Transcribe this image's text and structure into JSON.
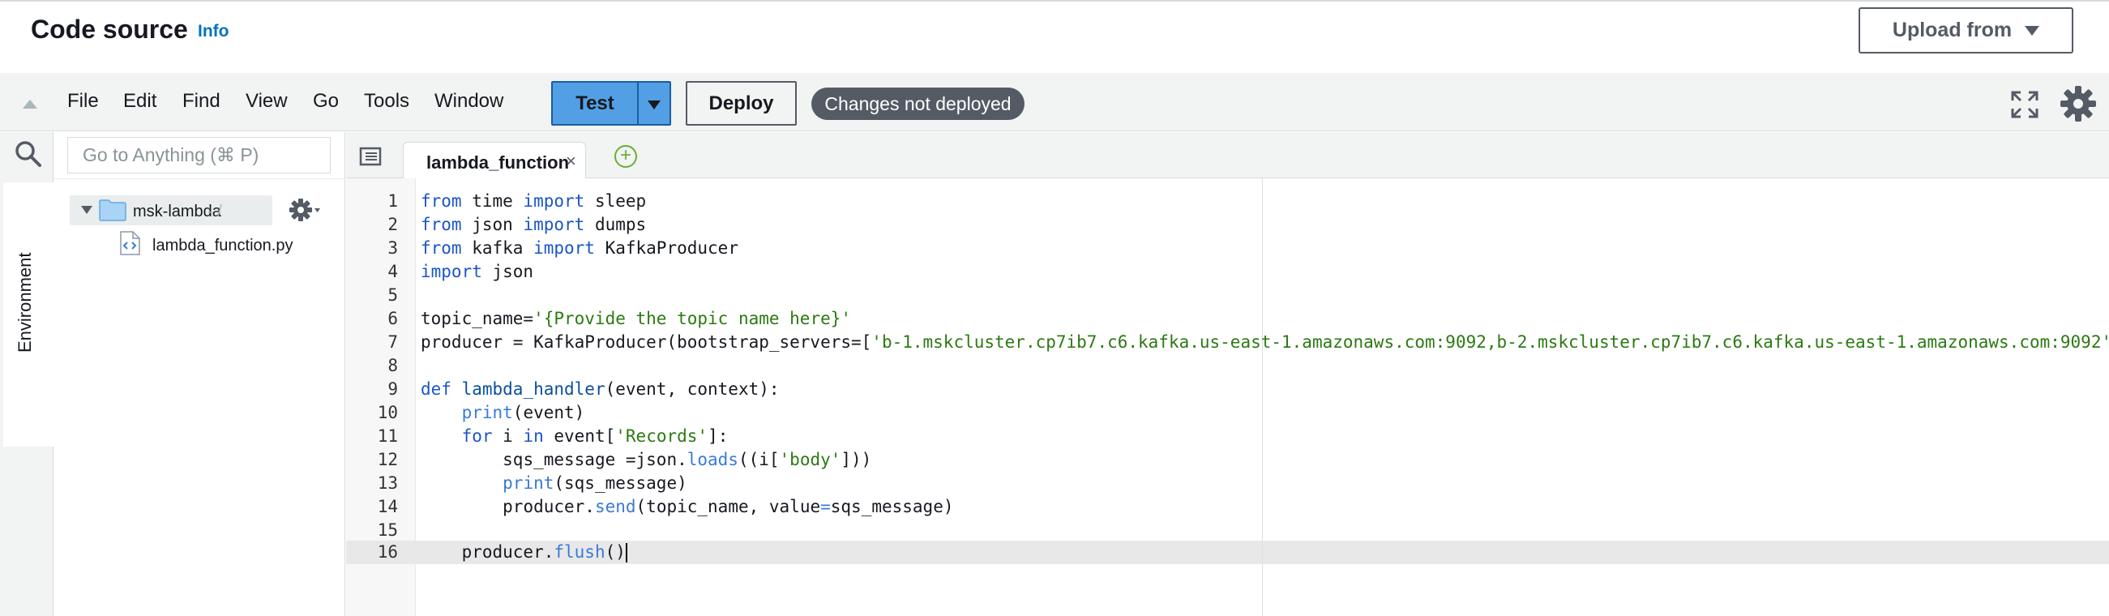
{
  "header": {
    "title": "Code source",
    "info_link": "Info",
    "upload_button": "Upload from"
  },
  "menubar": {
    "items": [
      "File",
      "Edit",
      "Find",
      "View",
      "Go",
      "Tools",
      "Window"
    ],
    "test_button": "Test",
    "deploy_button": "Deploy",
    "status_badge": "Changes not deployed"
  },
  "sidebar": {
    "search_placeholder": "Go to Anything (⌘ P)",
    "environment_tab": "Environment",
    "folder_name": "msk-lambda",
    "folder_path": "- /",
    "file_name": "lambda_function.py"
  },
  "editor": {
    "tab_label": "lambda_function",
    "tab_close": "×",
    "add_tab": "+",
    "line_numbers": [
      "1",
      "2",
      "3",
      "4",
      "5",
      "6",
      "7",
      "8",
      "9",
      "10",
      "11",
      "12",
      "13",
      "14",
      "15",
      "16"
    ],
    "code": {
      "l1": {
        "kw1": "from",
        "t1": " time ",
        "kw2": "import",
        "t2": " sleep"
      },
      "l2": {
        "kw1": "from",
        "t1": " json ",
        "kw2": "import",
        "t2": " dumps"
      },
      "l3": {
        "kw1": "from",
        "t1": " kafka ",
        "kw2": "import",
        "t2": " KafkaProducer"
      },
      "l4": {
        "kw1": "import",
        "t1": " json"
      },
      "l6": {
        "t1": "topic_name=",
        "s1": "'{Provide the topic name here}'"
      },
      "l7": {
        "t1": "producer = KafkaProducer(bootstrap_servers=[",
        "s1": "'b-1.mskcluster.cp7ib7.c6.kafka.us-east-1.amazonaws.com:9092,b-2.mskcluster.cp7ib7.c6.kafka.us-east-1.amazonaws.com:9092'"
      },
      "l9": {
        "kw1": "def",
        "fn1": " lambda_handler",
        "t1": "(event, context):"
      },
      "l10": {
        "indent": "    ",
        "c1": "print",
        "t1": "(event)"
      },
      "l11": {
        "indent": "    ",
        "kw1": "for",
        "t1": " i ",
        "kw2": "in",
        "t2": " event[",
        "s1": "'Records'",
        "t3": "]:"
      },
      "l12": {
        "indent": "        ",
        "t1": "sqs_message =json.",
        "c1": "loads",
        "t2": "((i[",
        "s1": "'body'",
        "t3": "]))"
      },
      "l13": {
        "indent": "        ",
        "c1": "print",
        "t1": "(sqs_message)"
      },
      "l14": {
        "indent": "        ",
        "t1": "producer.",
        "c1": "send",
        "t2": "(topic_name, value",
        "o1": "=",
        "t3": "sqs_message)"
      },
      "l16": {
        "indent": "    ",
        "t1": "producer.",
        "c1": "flush",
        "t2": "()"
      }
    }
  }
}
